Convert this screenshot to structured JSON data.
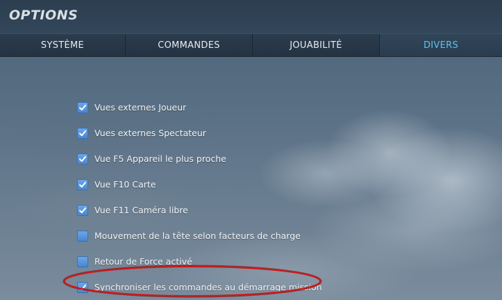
{
  "window": {
    "title": "OPTIONS"
  },
  "tabs": [
    {
      "label": "SYSTÈME",
      "active": false
    },
    {
      "label": "COMMANDES",
      "active": false
    },
    {
      "label": "JOUABILITÉ",
      "active": false
    },
    {
      "label": "DIVERS",
      "active": true
    }
  ],
  "options": [
    {
      "label": "Vues externes Joueur",
      "checked": true
    },
    {
      "label": "Vues externes Spectateur",
      "checked": true
    },
    {
      "label": "Vue F5 Appareil le plus proche",
      "checked": true
    },
    {
      "label": "Vue F10 Carte",
      "checked": true
    },
    {
      "label": "Vue F11 Caméra libre",
      "checked": true
    },
    {
      "label": "Mouvement de la tête selon facteurs de charge",
      "checked": false
    },
    {
      "label": "Retour de Force activé",
      "checked": false
    },
    {
      "label": "Synchroniser les commandes au démarrage mission",
      "checked": true
    }
  ],
  "colors": {
    "accent": "#5cc2f0",
    "checkbox": "#5a96dc",
    "annotation": "#d01818"
  }
}
